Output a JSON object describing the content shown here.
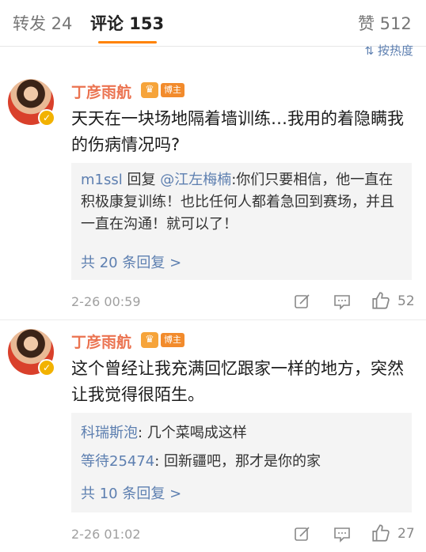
{
  "tabs": {
    "repost": "转发 24",
    "comments": "评论 153",
    "likes": "赞 512"
  },
  "sort": {
    "label": "按热度"
  },
  "comments": [
    {
      "user": "丁彦雨航",
      "badge": "博主",
      "text": "天天在一块场地隔着墙训练…我用的着隐瞒我的伤病情况吗?",
      "replies": [
        {
          "nick": "m1ssl",
          "middle": " 回复 ",
          "mention": "@江左梅楠",
          "text": ":你们只要相信，他一直在积极康复训练！也比任何人都着急回到赛场，并且一直在沟通！就可以了！"
        }
      ],
      "more": "共 20 条回复 >",
      "time": "2-26 00:59",
      "likes": "52"
    },
    {
      "user": "丁彦雨航",
      "badge": "博主",
      "text": "这个曾经让我充满回忆跟家一样的地方，突然让我觉得很陌生。",
      "replies": [
        {
          "nick": "科瑞斯泡",
          "text": ": 几个菜喝成这样"
        },
        {
          "nick": "等待25474",
          "text": ": 回新疆吧，那才是你的家"
        }
      ],
      "more": "共 10 条回复 >",
      "time": "2-26 01:02",
      "likes": "27"
    }
  ],
  "colors": {
    "accent": "#ff8200",
    "link": "#5d7fb0",
    "username": "#eb7350"
  }
}
